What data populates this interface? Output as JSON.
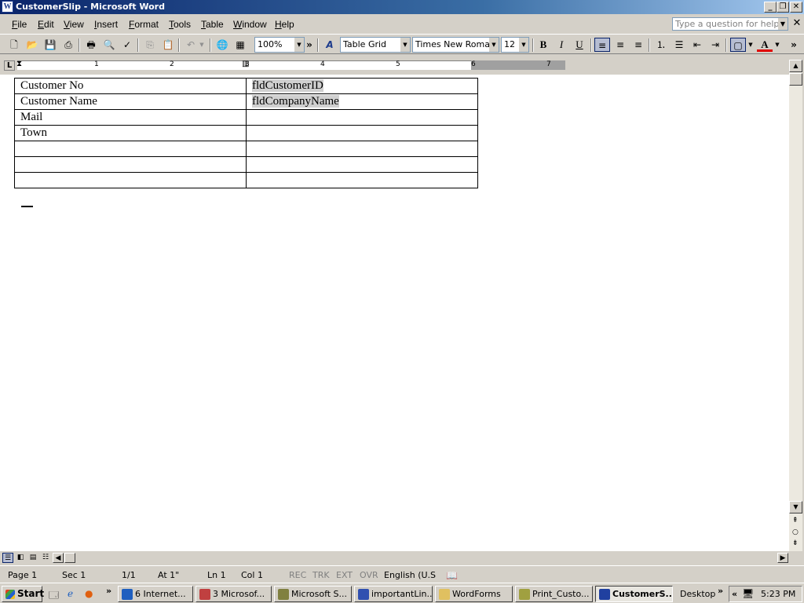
{
  "window": {
    "title": "CustomerSlip - Microsoft Word",
    "controls": {
      "minimize": "_",
      "restore": "❐",
      "close": "✕"
    }
  },
  "menubar": {
    "items": [
      {
        "ul": "F",
        "rest": "ile"
      },
      {
        "ul": "E",
        "rest": "dit"
      },
      {
        "ul": "V",
        "rest": "iew"
      },
      {
        "ul": "I",
        "rest": "nsert"
      },
      {
        "ul": "F",
        "rest": "ormat"
      },
      {
        "ul": "T",
        "rest": "ools"
      },
      {
        "ul": "T",
        "rest": "able"
      },
      {
        "ul": "W",
        "rest": "indow"
      },
      {
        "ul": "H",
        "rest": "elp"
      }
    ],
    "help_placeholder": "Type a question for help",
    "close_doc": "✕"
  },
  "toolbar": {
    "zoom": "100%",
    "style": "Table Grid",
    "font": "Times New Roman",
    "size": "12",
    "bold": "B",
    "italic": "I",
    "underline": "U",
    "more": "»",
    "font_color": "#e00000"
  },
  "ruler": {
    "numbers": [
      "1",
      "2",
      "3",
      "4",
      "5",
      "6",
      "7"
    ],
    "tab_selector": "L"
  },
  "document": {
    "table": [
      {
        "label": "Customer No",
        "field": "fldCustomerID"
      },
      {
        "label": "Customer Name",
        "field": "fldCompanyName"
      },
      {
        "label": "Mail",
        "field": ""
      },
      {
        "label": "Town",
        "field": ""
      },
      {
        "label": "",
        "field": ""
      },
      {
        "label": "",
        "field": ""
      },
      {
        "label": "",
        "field": ""
      }
    ]
  },
  "statusbar": {
    "page": "Page  1",
    "sec": "Sec  1",
    "pages": "1/1",
    "at": "At  1\"",
    "ln": "Ln  1",
    "col": "Col  1",
    "rec": "REC",
    "trk": "TRK",
    "ext": "EXT",
    "ovr": "OVR",
    "lang": "English (U.S"
  },
  "taskbar": {
    "start": "Start",
    "tasks": [
      {
        "label": "6 Internet...",
        "color": "#1f5fbf"
      },
      {
        "label": "3 Microsof...",
        "color": "#c04040"
      },
      {
        "label": "Microsoft S...",
        "color": "#808040"
      },
      {
        "label": "importantLin...",
        "color": "#3050b0"
      },
      {
        "label": "WordForms",
        "color": "#e0c060"
      },
      {
        "label": "Print_Custo...",
        "color": "#a0a040"
      },
      {
        "label": "CustomerS...",
        "color": "#2040a0"
      }
    ],
    "desktop": "Desktop",
    "clock": "5:23 PM"
  }
}
